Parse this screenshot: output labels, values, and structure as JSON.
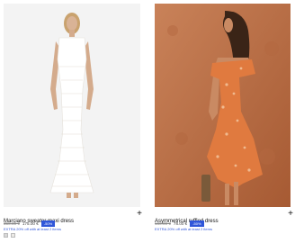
{
  "products": [
    {
      "name": "Marciano sweater maxi dress",
      "old_price": "350.00 €",
      "new_price": "175.00 €",
      "badge": "-50%",
      "promo": "EXTRA 20% off with at least 2 items",
      "add_icon": "plus-icon"
    },
    {
      "name": "Asymmetrical ruffled dress",
      "old_price": "160.00 €",
      "new_price": "78.00 €",
      "badge": "-50%",
      "promo": "EXTRA 20% off with at least 2 items",
      "add_icon": "plus-icon"
    }
  ],
  "colors": {
    "badge": "#2f56d9",
    "promo": "#2f56d9"
  }
}
